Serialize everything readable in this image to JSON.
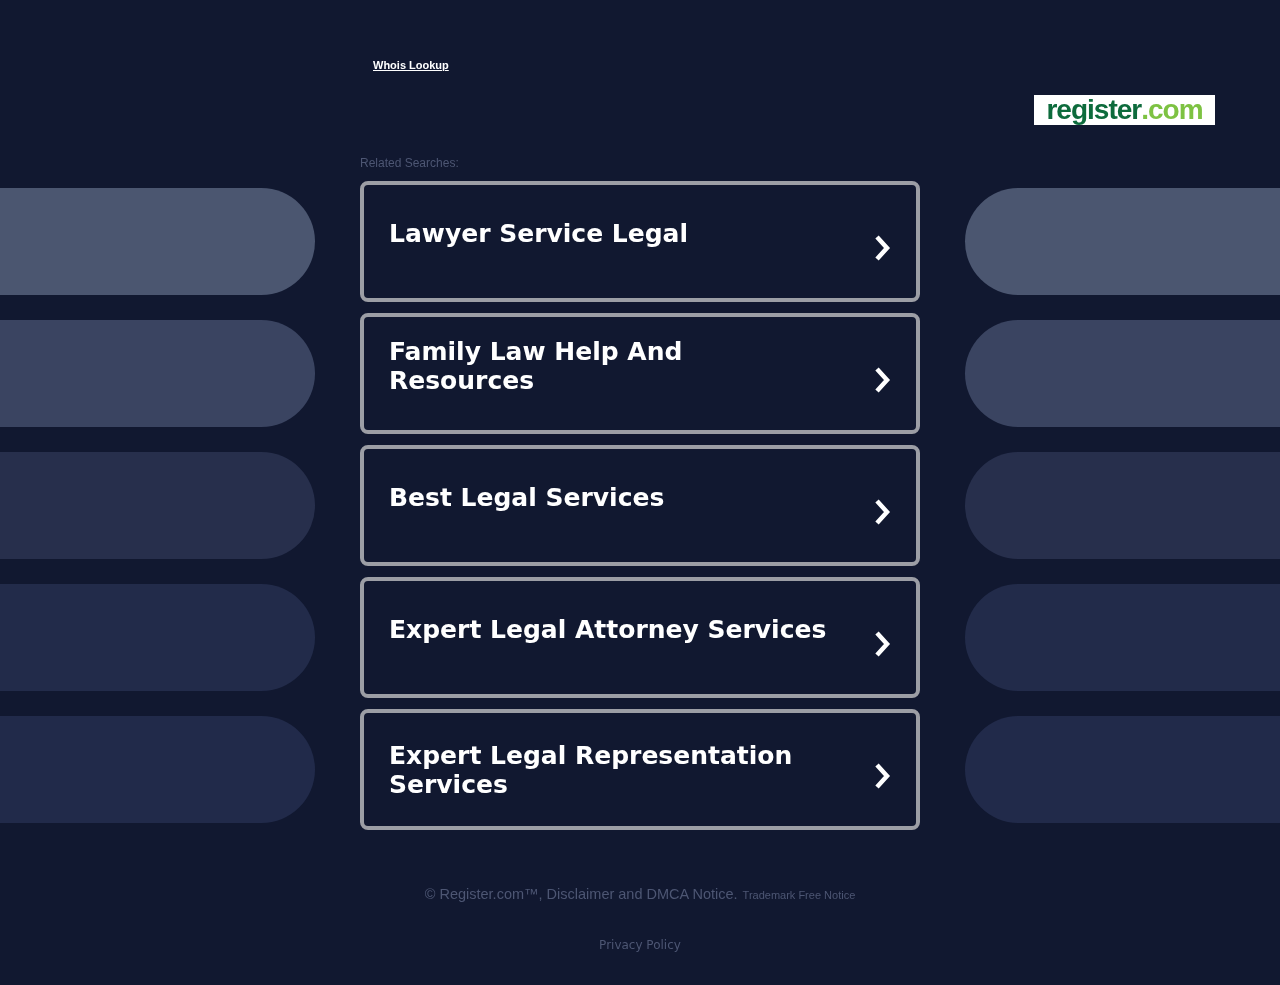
{
  "header": {
    "whois_link": "Whois Lookup",
    "logo": {
      "name": "register",
      "suffix": ".com"
    }
  },
  "related_label": "Related Searches:",
  "searches": [
    {
      "label": "Lawyer Service Legal"
    },
    {
      "label": "Family Law Help And Resources"
    },
    {
      "label": "Best Legal Services"
    },
    {
      "label": "Expert Legal Attorney Services"
    },
    {
      "label": "Expert Legal Representation Services"
    }
  ],
  "footer": {
    "copyright": "© Register.com™, Disclaimer and DMCA Notice.",
    "trademark_link": "Trademark Free Notice",
    "privacy_link": "Privacy Policy"
  }
}
